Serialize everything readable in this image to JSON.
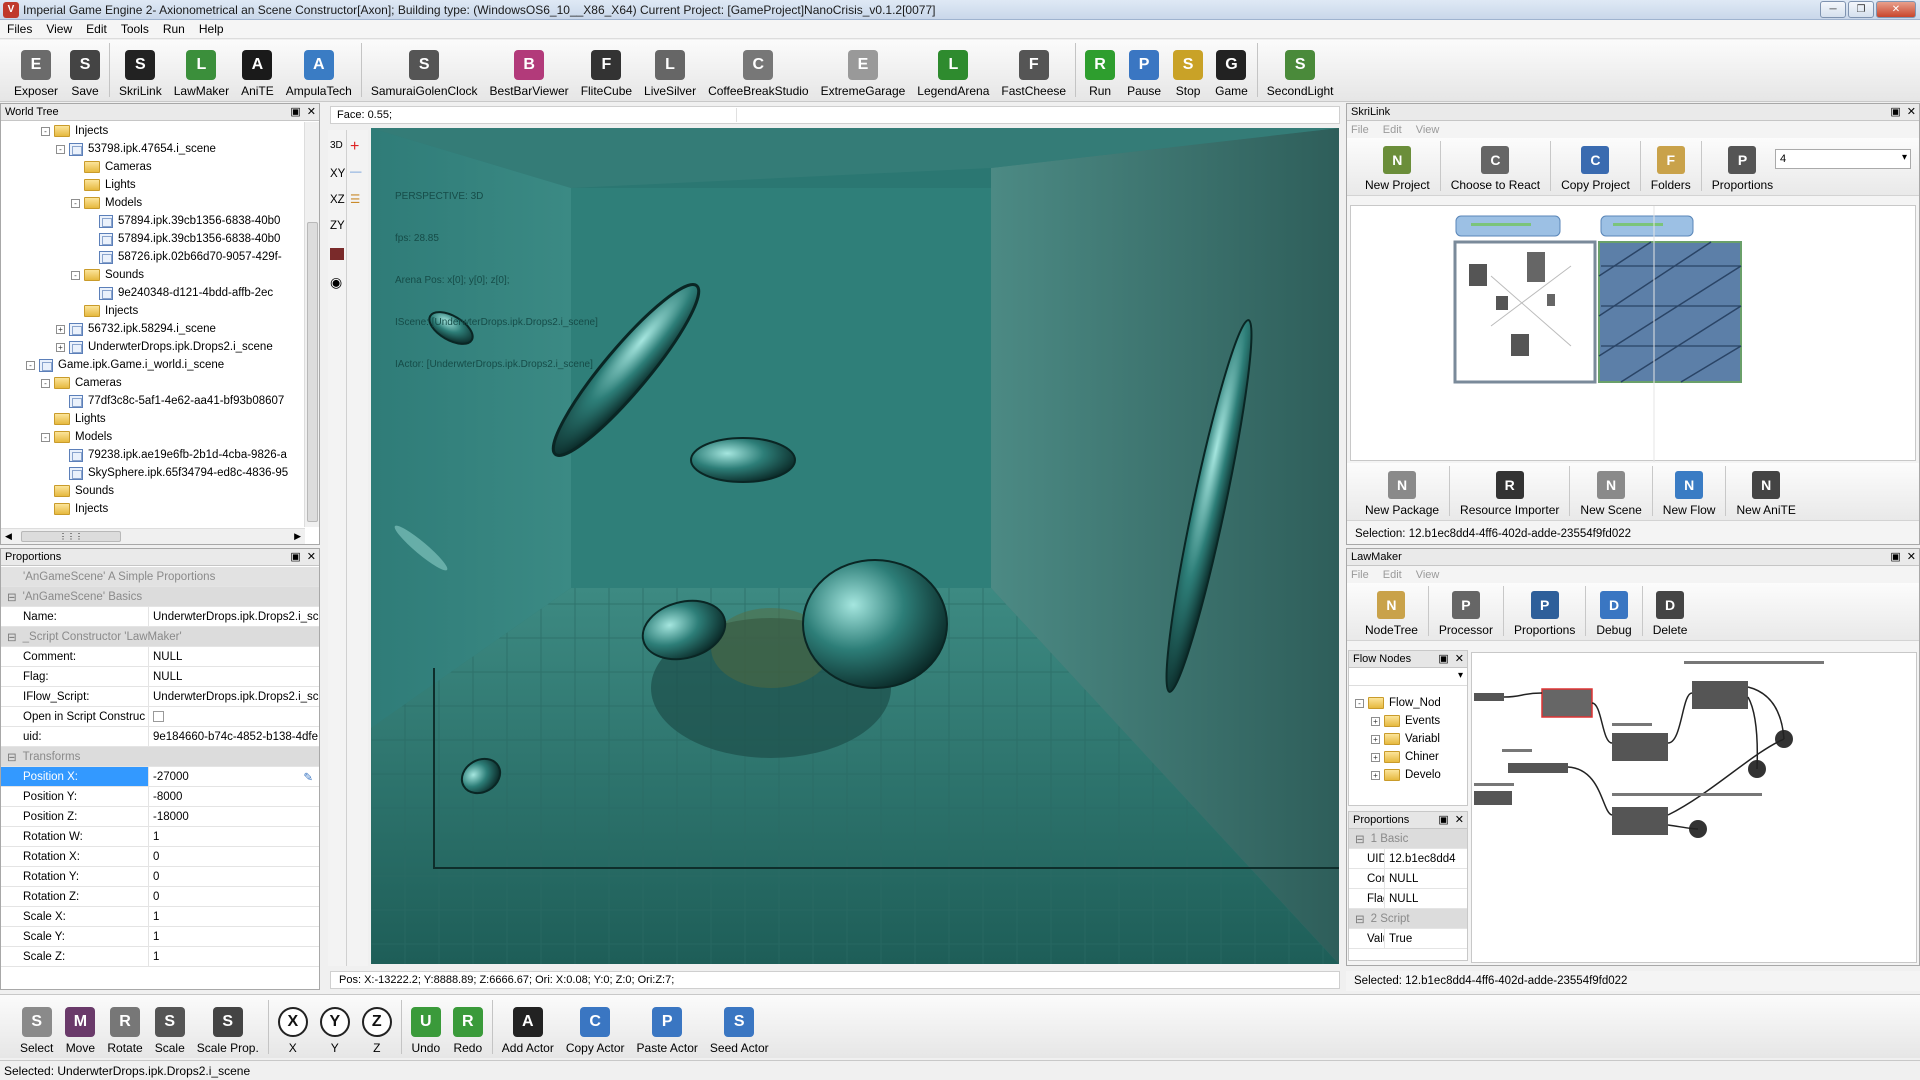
{
  "window": {
    "title": "Imperial Game Engine 2- Axionometrical an Scene Constructor[Axon]; Building type: (WindowsOS6_10__X86_X64) Current Project: [GameProject]NanoCrisis_v0.1.2[0077]",
    "app_icon": "V"
  },
  "menu": [
    "Files",
    "View",
    "Edit",
    "Tools",
    "Run",
    "Help"
  ],
  "toolbar": [
    {
      "label": "Exposer",
      "icon": "camera-icon",
      "color": "#6b6b6b"
    },
    {
      "label": "Save",
      "icon": "floppy-icon",
      "color": "#444444"
    },
    {
      "label": "SkriLink",
      "icon": "eagle-icon",
      "color": "#222222"
    },
    {
      "label": "LawMaker",
      "icon": "chart-icon",
      "color": "#3b8f3b"
    },
    {
      "label": "AniTE",
      "icon": "clapper-icon",
      "color": "#1a1a1a"
    },
    {
      "label": "AmpulaTech",
      "icon": "ampule-icon",
      "color": "#3a7cc4"
    },
    {
      "label": "SamuraiGolenClock",
      "icon": "mask-icon",
      "color": "#555555"
    },
    {
      "label": "BestBarViewer",
      "icon": "drum-icon",
      "color": "#b23a7a"
    },
    {
      "label": "FliteCube",
      "icon": "loop-icon",
      "color": "#333333"
    },
    {
      "label": "LiveSilver",
      "icon": "diamond-icon",
      "color": "#666666"
    },
    {
      "label": "CoffeeBreakStudio",
      "icon": "atom-icon",
      "color": "#777777"
    },
    {
      "label": "ExtremeGarage",
      "icon": "dots-icon",
      "color": "#999999"
    },
    {
      "label": "LegendArena",
      "icon": "arena-icon",
      "color": "#2e8b2e"
    },
    {
      "label": "FastCheese",
      "icon": "sliders-icon",
      "color": "#555555"
    },
    {
      "label": "Run",
      "icon": "run-icon",
      "color": "#2e9e2e"
    },
    {
      "label": "Pause",
      "icon": "pause-icon",
      "color": "#3a76c2"
    },
    {
      "label": "Stop",
      "icon": "stop-icon",
      "color": "#c9a227"
    },
    {
      "label": "Game",
      "icon": "eagle-icon",
      "color": "#222222"
    },
    {
      "label": "SecondLight",
      "icon": "lamp-icon",
      "color": "#4a8a3a"
    }
  ],
  "world_tree": {
    "title": "World Tree",
    "rows": [
      {
        "text": "Injects",
        "indent": 2,
        "kind": "folder",
        "exp": "-"
      },
      {
        "text": "53798.ipk.47654.i_scene",
        "indent": 3,
        "kind": "scene",
        "exp": "-"
      },
      {
        "text": "Cameras",
        "indent": 4,
        "kind": "folder",
        "exp": ""
      },
      {
        "text": "Lights",
        "indent": 4,
        "kind": "folder",
        "exp": ""
      },
      {
        "text": "Models",
        "indent": 4,
        "kind": "folder",
        "exp": "-"
      },
      {
        "text": "57894.ipk.39cb1356-6838-40b0",
        "indent": 5,
        "kind": "scene",
        "exp": ""
      },
      {
        "text": "57894.ipk.39cb1356-6838-40b0",
        "indent": 5,
        "kind": "scene",
        "exp": ""
      },
      {
        "text": "58726.ipk.02b66d70-9057-429f-",
        "indent": 5,
        "kind": "scene",
        "exp": ""
      },
      {
        "text": "Sounds",
        "indent": 4,
        "kind": "folder",
        "exp": "-"
      },
      {
        "text": "9e240348-d121-4bdd-affb-2ec",
        "indent": 5,
        "kind": "scene",
        "exp": ""
      },
      {
        "text": "Injects",
        "indent": 4,
        "kind": "folder",
        "exp": ""
      },
      {
        "text": "56732.ipk.58294.i_scene",
        "indent": 3,
        "kind": "scene",
        "exp": "+"
      },
      {
        "text": "UnderwterDrops.ipk.Drops2.i_scene",
        "indent": 3,
        "kind": "scene",
        "exp": "+"
      },
      {
        "text": "Game.ipk.Game.i_world.i_scene",
        "indent": 1,
        "kind": "scene",
        "exp": "-"
      },
      {
        "text": "Cameras",
        "indent": 2,
        "kind": "folder",
        "exp": "-"
      },
      {
        "text": "77df3c8c-5af1-4e62-aa41-bf93b08607",
        "indent": 3,
        "kind": "scene",
        "exp": ""
      },
      {
        "text": "Lights",
        "indent": 2,
        "kind": "folder",
        "exp": ""
      },
      {
        "text": "Models",
        "indent": 2,
        "kind": "folder",
        "exp": "-"
      },
      {
        "text": "79238.ipk.ae19e6fb-2b1d-4cba-9826-a",
        "indent": 3,
        "kind": "scene",
        "exp": ""
      },
      {
        "text": "SkySphere.ipk.65f34794-ed8c-4836-95",
        "indent": 3,
        "kind": "scene",
        "exp": ""
      },
      {
        "text": "Sounds",
        "indent": 2,
        "kind": "folder",
        "exp": ""
      },
      {
        "text": "Injects",
        "indent": 2,
        "kind": "folder",
        "exp": ""
      }
    ]
  },
  "proportions_left": {
    "title": "Proportions",
    "rows": [
      {
        "type": "desc",
        "k": "'AnGameScene' A Simple Proportions",
        "v": ""
      },
      {
        "type": "section",
        "k": "'AnGameScene' Basics",
        "v": ""
      },
      {
        "type": "row",
        "k": "Name:",
        "v": "UnderwterDrops.ipk.Drops2.i_sc"
      },
      {
        "type": "section",
        "k": "_Script Constructor 'LawMaker'",
        "v": ""
      },
      {
        "type": "row",
        "k": "Comment:",
        "v": "NULL"
      },
      {
        "type": "row",
        "k": "Flag:",
        "v": "NULL"
      },
      {
        "type": "row",
        "k": "IFlow_Script:",
        "v": "UnderwterDrops.ipk.Drops2.i_sc"
      },
      {
        "type": "check",
        "k": "Open in Script Construc",
        "v": ""
      },
      {
        "type": "row",
        "k": "uid:",
        "v": "9e184660-b74c-4852-b138-4dfe"
      },
      {
        "type": "section",
        "k": "Transforms",
        "v": ""
      },
      {
        "type": "selected",
        "k": "Position X:",
        "v": "-27000"
      },
      {
        "type": "row",
        "k": "Position Y:",
        "v": "-8000"
      },
      {
        "type": "row",
        "k": "Position Z:",
        "v": "-18000"
      },
      {
        "type": "row",
        "k": "Rotation W:",
        "v": "1"
      },
      {
        "type": "row",
        "k": "Rotation X:",
        "v": "0"
      },
      {
        "type": "row",
        "k": "Rotation Y:",
        "v": "0"
      },
      {
        "type": "row",
        "k": "Rotation Z:",
        "v": "0"
      },
      {
        "type": "row",
        "k": "Scale X:",
        "v": "1"
      },
      {
        "type": "row",
        "k": "Scale Y:",
        "v": "1"
      },
      {
        "type": "row",
        "k": "Scale Z:",
        "v": "1"
      }
    ]
  },
  "viewport": {
    "face_label": "Face: 0.55;",
    "side_buttons": [
      "3D",
      "XY",
      "XZ",
      "ZY"
    ],
    "overlay_lines": [
      "PERSPECTIVE: 3D",
      "fps: 28.85",
      "Arena Pos: x[0]; y[0]; z[0];",
      "IScene: [UnderwterDrops.ipk.Drops2.i_scene]",
      "IActor: [UnderwterDrops.ipk.Drops2.i_scene]"
    ],
    "status": "Pos:  X:-13222.2; Y:8888.89; Z:6666.67; Ori: X:0.08; Y:0; Z:0; Ori:Z:7;"
  },
  "skrilink": {
    "title": "SkriLink",
    "submenu": [
      "File",
      "Edit",
      "View"
    ],
    "tools": [
      {
        "label": "New Project",
        "icon": "new-project-icon",
        "color": "#6b8e3a"
      },
      {
        "label": "Choose to React",
        "icon": "camera-icon",
        "color": "#666666"
      },
      {
        "label": "Copy Project",
        "icon": "copy-icon",
        "color": "#3a6bb0"
      },
      {
        "label": "Folders",
        "icon": "folders-icon",
        "color": "#c9a24a"
      },
      {
        "label": "Proportions",
        "icon": "magnifier-icon",
        "color": "#555555"
      }
    ],
    "dropdown_value": "4",
    "tools2": [
      {
        "label": "New Package",
        "icon": "package-icon",
        "color": "#8a8a8a"
      },
      {
        "label": "Resource Importer",
        "icon": "eagle-icon",
        "color": "#333333"
      },
      {
        "label": "New Scene",
        "icon": "scene-cube-icon",
        "color": "#8a8a8a"
      },
      {
        "label": "New Flow",
        "icon": "flow-icon",
        "color": "#3a7cc4"
      },
      {
        "label": "New AniTE",
        "icon": "anite-icon",
        "color": "#444444"
      }
    ],
    "selection": "Selection: 12.b1ec8dd4-4ff6-402d-adde-23554f9fd022",
    "accent_green": "#7bc47b"
  },
  "lawmaker": {
    "title": "LawMaker",
    "submenu": [
      "File",
      "Edit",
      "View"
    ],
    "tools": [
      {
        "label": "NodeTree",
        "icon": "nodetree-icon",
        "color": "#c9a24a"
      },
      {
        "label": "Processor",
        "icon": "gear-icon",
        "color": "#666666"
      },
      {
        "label": "Proportions",
        "icon": "gear-blue-icon",
        "color": "#2e5f9a"
      },
      {
        "label": "Debug",
        "icon": "bars-icon",
        "color": "#3a76c2"
      },
      {
        "label": "Delete",
        "icon": "trash-icon",
        "color": "#444444"
      }
    ],
    "flow_nodes_title": "Flow Nodes",
    "flow_tree": [
      "Flow_Nod",
      "Events",
      "Variabl",
      "Chiner",
      "Develo"
    ],
    "props_title": "Proportions",
    "props": [
      {
        "type": "section",
        "k": "1 Basic",
        "v": ""
      },
      {
        "type": "row",
        "k": "UID:",
        "v": "12.b1ec8dd4"
      },
      {
        "type": "row",
        "k": "Com",
        "v": "NULL"
      },
      {
        "type": "row",
        "k": "Flag:",
        "v": "NULL"
      },
      {
        "type": "section",
        "k": "2 Script",
        "v": ""
      },
      {
        "type": "row",
        "k": "Valu",
        "v": "True"
      }
    ],
    "selected": "Selected:   12.b1ec8dd4-4ff6-402d-adde-23554f9fd022"
  },
  "bottom_toolbar": [
    {
      "label": "Select",
      "icon": "cursor-icon"
    },
    {
      "label": "Move",
      "icon": "move-icon"
    },
    {
      "label": "Rotate",
      "icon": "rotate-icon"
    },
    {
      "label": "Scale",
      "icon": "scale-icon"
    },
    {
      "label": "Scale Prop.",
      "icon": "scale-prop-icon"
    },
    {
      "label": "X",
      "icon": "axis-x-icon"
    },
    {
      "label": "Y",
      "icon": "axis-y-icon"
    },
    {
      "label": "Z",
      "icon": "axis-z-icon"
    },
    {
      "label": "Undo",
      "icon": "undo-icon"
    },
    {
      "label": "Redo",
      "icon": "redo-icon"
    },
    {
      "label": "Add Actor",
      "icon": "clapper-icon"
    },
    {
      "label": "Copy Actor",
      "icon": "copy-actor-icon"
    },
    {
      "label": "Paste Actor",
      "icon": "paste-actor-icon"
    },
    {
      "label": "Seed Actor",
      "icon": "seed-actor-icon"
    }
  ],
  "status_bar": "Selected: UnderwterDrops.ipk.Drops2.i_scene"
}
